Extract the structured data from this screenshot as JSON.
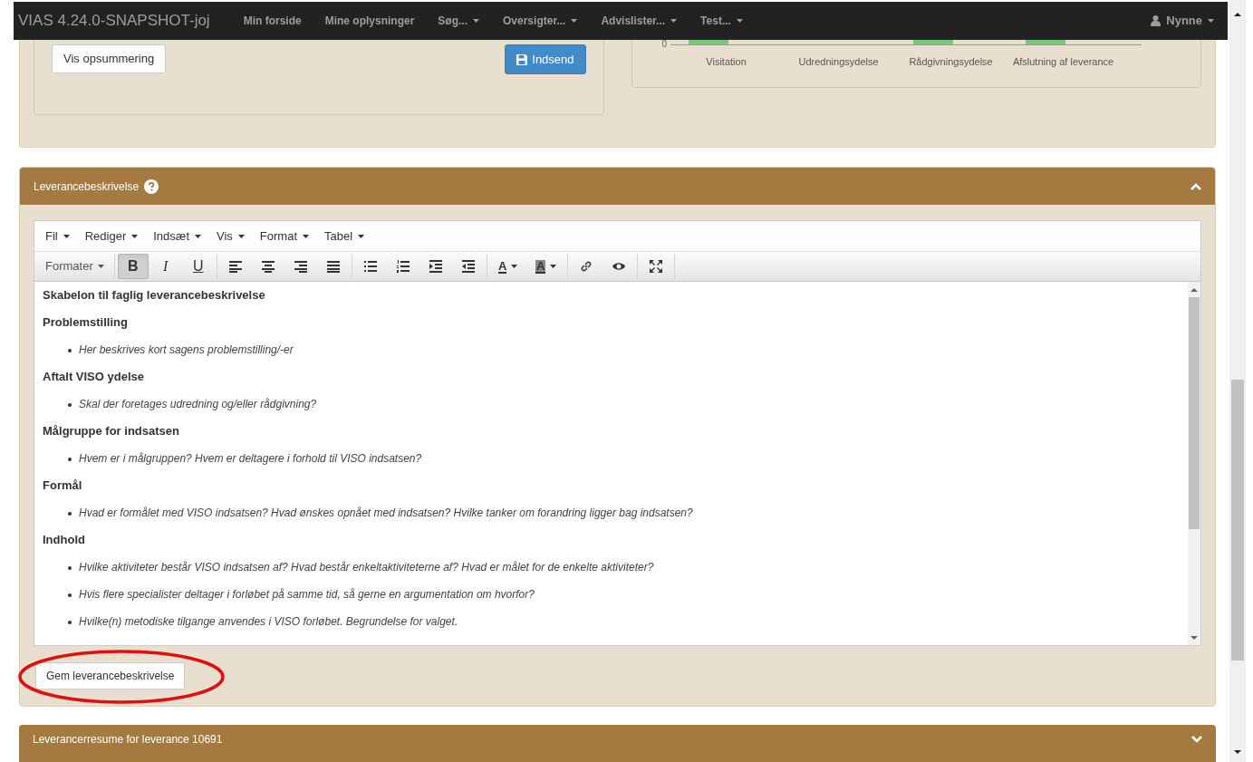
{
  "navbar": {
    "brand": "VIAS 4.24.0-SNAPSHOT-joj",
    "items": [
      {
        "label": "Min forside",
        "dropdown": false
      },
      {
        "label": "Mine oplysninger",
        "dropdown": false
      },
      {
        "label": "Søg...",
        "dropdown": true
      },
      {
        "label": "Oversigter...",
        "dropdown": true
      },
      {
        "label": "Advislister...",
        "dropdown": true
      },
      {
        "label": "Test...",
        "dropdown": true
      }
    ],
    "user": "Nynne"
  },
  "top_panel": {
    "summary_button": "Vis opsummering",
    "submit_button": "Indsend",
    "chart_axis_label": "0",
    "chart_categories": [
      "Visitation",
      "Udredningsydelse",
      "Rådgivningsydelse",
      "Afslutning af leverance"
    ]
  },
  "description_panel": {
    "title": "Leverancebeskrivelse",
    "expanded": true,
    "menu": [
      "Fil",
      "Rediger",
      "Indsæt",
      "Vis",
      "Format",
      "Tabel"
    ],
    "format_dropdown": "Formater",
    "style_buttons": [
      {
        "label": "B",
        "selected": true
      },
      {
        "label": "I",
        "selected": false
      },
      {
        "label": "U",
        "selected": false
      }
    ],
    "color_buttons": [
      "A",
      "A"
    ],
    "content": [
      {
        "kind": "heading",
        "text": "Skabelon til faglig leverancebeskrivelse"
      },
      {
        "kind": "heading",
        "text": "Problemstilling"
      },
      {
        "kind": "bullet",
        "text": "Her beskrives kort sagens problemstilling/-er"
      },
      {
        "kind": "heading",
        "text": "Aftalt VISO ydelse"
      },
      {
        "kind": "bullet",
        "text": "Skal der foretages udredning og/eller rådgivning?"
      },
      {
        "kind": "heading",
        "text": "Målgruppe for indsatsen"
      },
      {
        "kind": "bullet",
        "text": "Hvem er i målgruppen? Hvem er deltagere i forhold til VISO indsatsen?"
      },
      {
        "kind": "heading",
        "text": "Formål"
      },
      {
        "kind": "bullet",
        "text": "Hvad er formålet med VISO indsatsen? Hvad ønskes opnået med indsatsen? Hvilke tanker om forandring ligger bag indsatsen?"
      },
      {
        "kind": "heading",
        "text": "Indhold"
      },
      {
        "kind": "bullet",
        "text": "Hvilke aktiviteter består VISO indsatsen af? Hvad består enkeltaktiviteterne af? Hvad er målet for de enkelte aktiviteter?"
      },
      {
        "kind": "bullet",
        "text": "Hvis flere specialister deltager i forløbet på samme tid, så gerne en argumentation om hvorfor?"
      },
      {
        "kind": "bullet",
        "text": "Hvilke(n) metodiske tilgange anvendes i VISO forløbet. Begrundelse for valget."
      }
    ],
    "save_button": "Gem leverancebeskrivelse"
  },
  "resume_panel": {
    "title": "Leverancerresume for leverance 10691",
    "expanded": false
  }
}
